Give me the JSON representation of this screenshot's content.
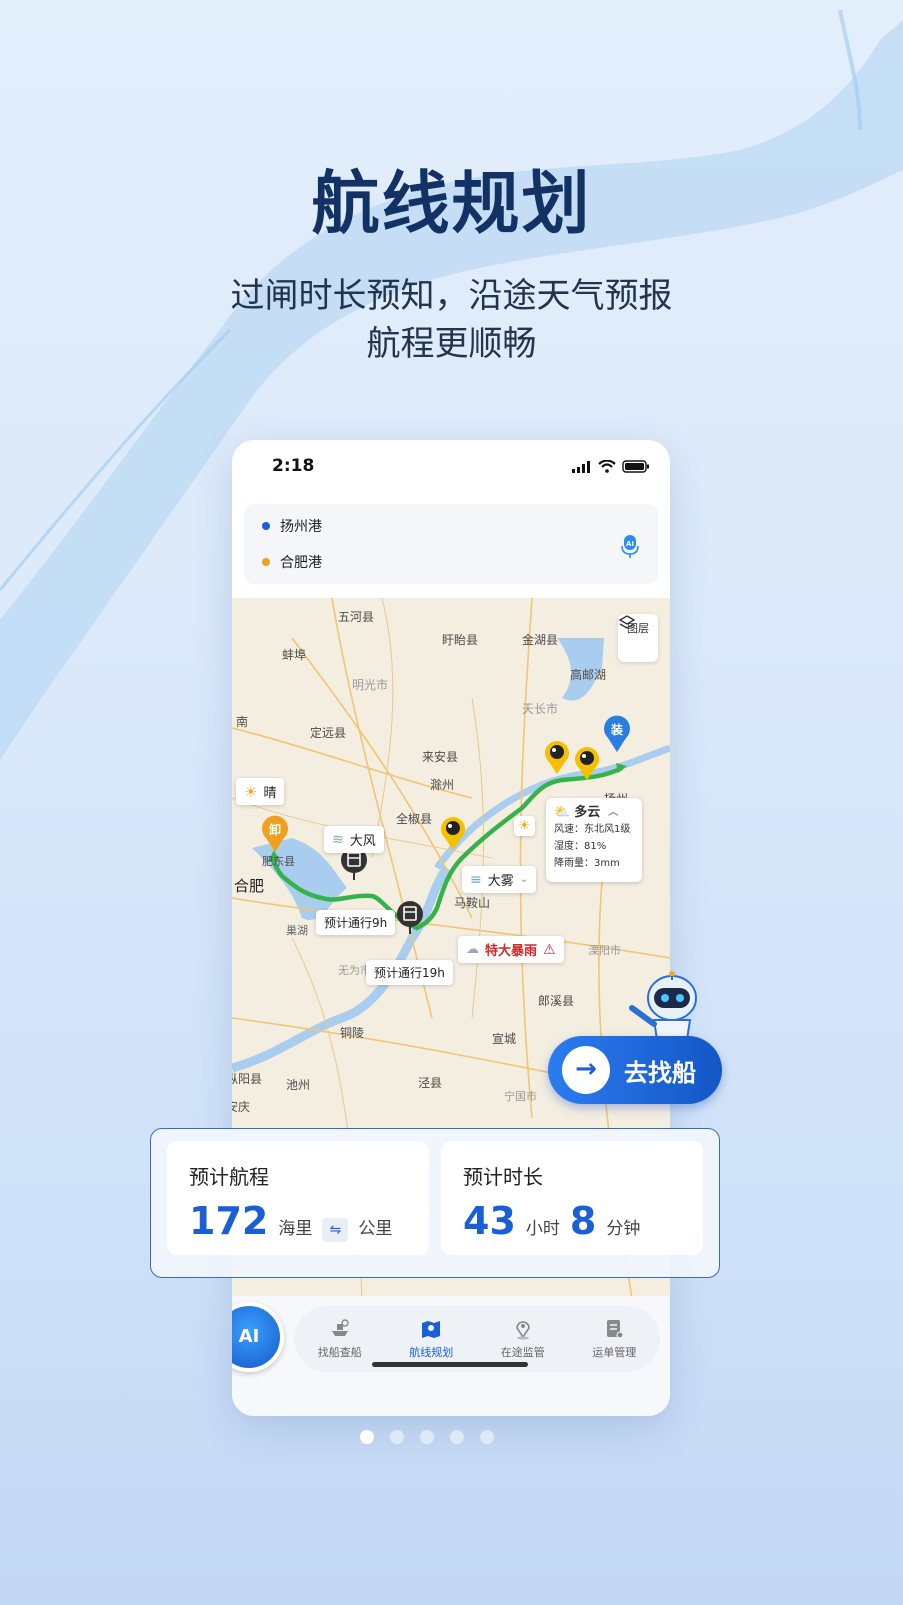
{
  "hero": {
    "title": "航线规划",
    "subtitle_line1": "过闸时长预知，沿途天气预报",
    "subtitle_line2": "航程更顺畅"
  },
  "status_bar": {
    "time": "2:18"
  },
  "route": {
    "origin": "扬州港",
    "destination": "合肥港",
    "origin_color": "#1b5fd6",
    "destination_color": "#f0a020"
  },
  "map": {
    "layer_label": "图层",
    "places": {
      "wuhe": "五河县",
      "xuyi": "盱眙县",
      "jinhu": "金湖县",
      "bengbu": "蚌埠",
      "gaoyouhu": "高邮湖",
      "mingguang": "明光市",
      "tianchang": "天长市",
      "dingyuan": "定远县",
      "laian": "来安县",
      "chuzhou": "滁州",
      "quanjiao": "全椒县",
      "nan": "南",
      "hefei": "合肥",
      "chaohu": "巢湖",
      "maanshan": "马鞍山",
      "wuwei": "无为市",
      "liyang": "溧阳市",
      "langxi": "郎溪县",
      "tongling": "铜陵",
      "xuancheng": "宣城",
      "zongyang": "枞阳县",
      "chizhou": "池州",
      "jingxian": "泾县",
      "anqing": "安庆",
      "ningguo": "宁国市",
      "yangzhou": "扬州",
      "feidong": "肥东县"
    },
    "marker_load": "装",
    "marker_unload": "卸",
    "weather_sunny": "晴",
    "weather_wind": "大风",
    "weather_fog": "大雾",
    "weather_storm": "特大暴雨",
    "lock_1": "预计通行9h",
    "lock_2": "预计通行19h",
    "weather_card": {
      "title": "多云",
      "wind": "风速：东北风1级",
      "humidity": "湿度：81%",
      "rain": "降雨量：3mm"
    }
  },
  "tabbar": {
    "ai_label": "AI",
    "tabs": [
      {
        "label": "找船查船",
        "icon": "ship-search-icon"
      },
      {
        "label": "航线规划",
        "icon": "route-map-icon"
      },
      {
        "label": "在途监管",
        "icon": "location-pin-icon"
      },
      {
        "label": "运单管理",
        "icon": "waybill-icon"
      }
    ]
  },
  "summary": {
    "distance_label": "预计航程",
    "distance_value": "172",
    "distance_unit": "海里",
    "distance_alt_unit": "公里",
    "duration_label": "预计时长",
    "hours_value": "43",
    "hours_unit": "小时",
    "minutes_value": "8",
    "minutes_unit": "分钟"
  },
  "cta": {
    "label": "去找船"
  },
  "pagination": {
    "count": 5,
    "active": 1
  }
}
